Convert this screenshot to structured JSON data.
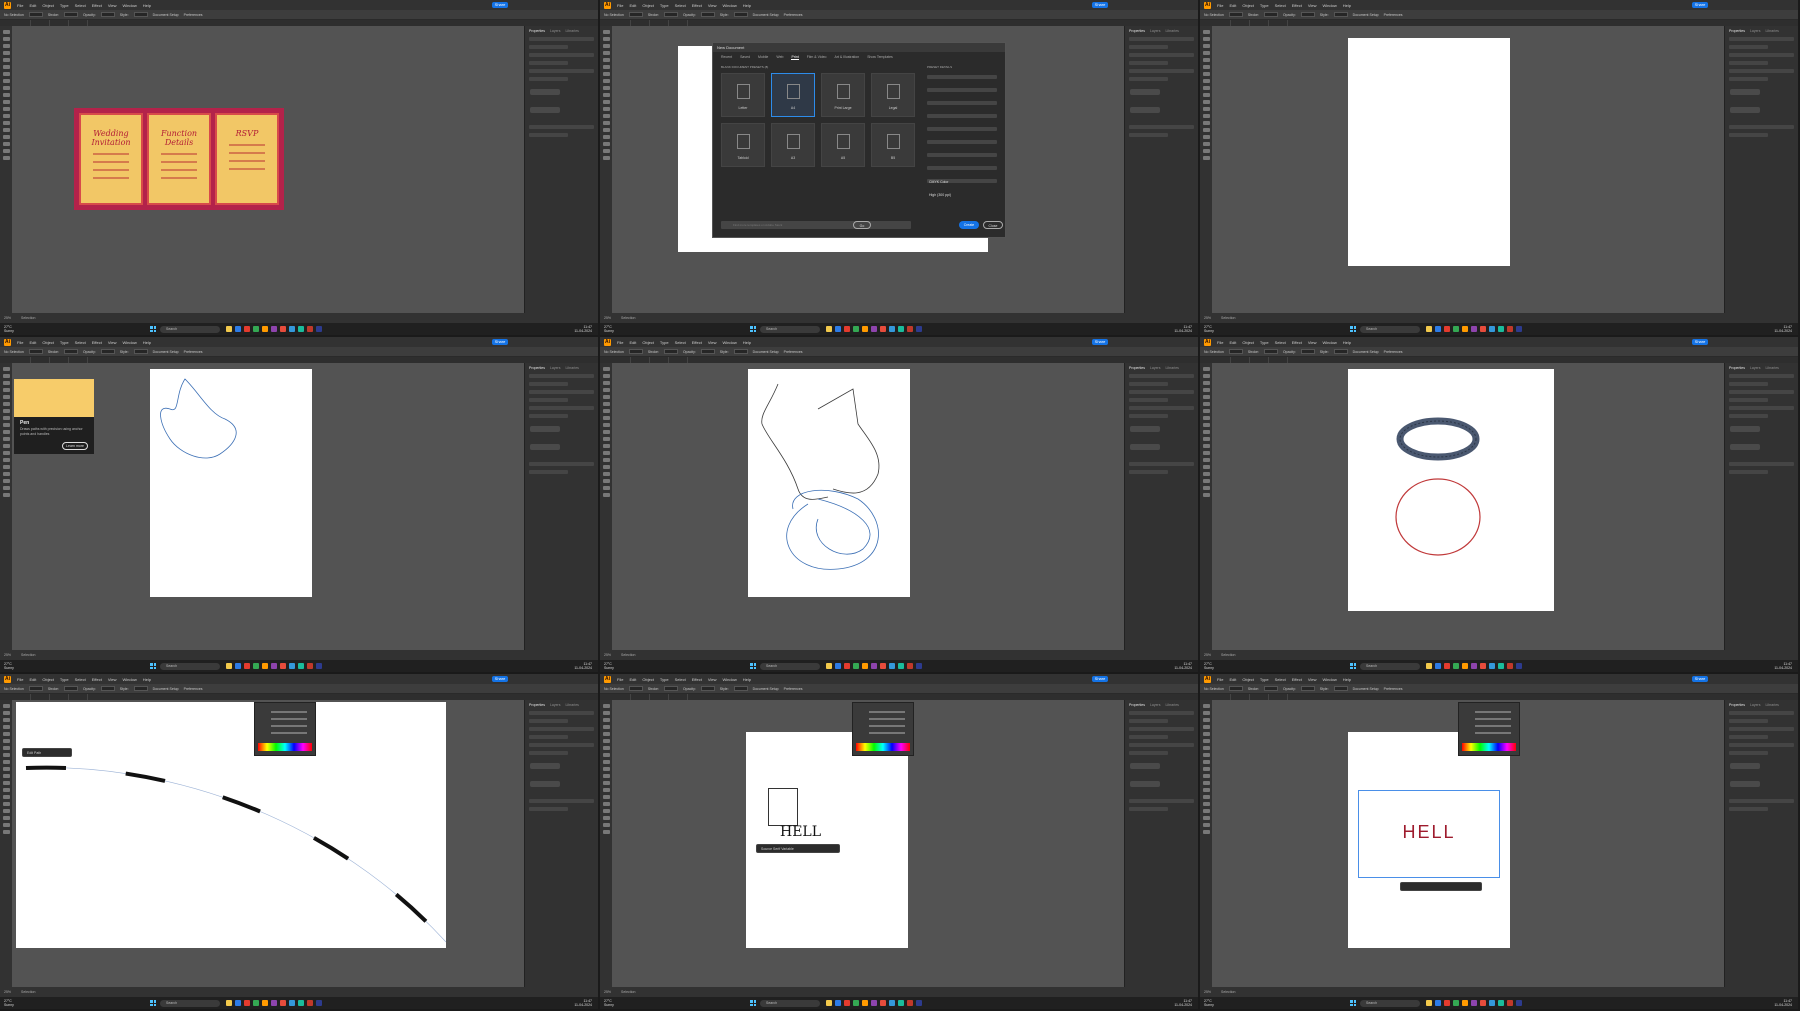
{
  "menu": {
    "app_icon": "Ai",
    "items": [
      "File",
      "Edit",
      "Object",
      "Type",
      "Select",
      "Effect",
      "View",
      "Window",
      "Help"
    ],
    "share_label": "Share"
  },
  "control_bar": {
    "no_selection": "No Selection",
    "stroke_label": "Stroke:",
    "style_label": "Style:",
    "opacity_label": "Opacity:",
    "document_setup": "Document Setup",
    "preferences": "Preferences"
  },
  "right_panel": {
    "tabs": [
      "Properties",
      "Layers",
      "Libraries"
    ],
    "document_setup": "Document Setup",
    "preferences": "Preferences"
  },
  "taskbar": {
    "search_placeholder": "Search",
    "weather": "27°C\nSunny",
    "clock": "11:47\n11-04-2024",
    "icon_colors": [
      "#f2c94c",
      "#2d7be5",
      "#e33b2e",
      "#34a853",
      "#ff9a00",
      "#8e44ad",
      "#e74c3c",
      "#3498db",
      "#1abc9c",
      "#c0392b",
      "#2d3b8e"
    ]
  },
  "panes": [
    {
      "id": "invitation",
      "cards": [
        "Wedding Invitation",
        "Function Details",
        "RSVP"
      ]
    },
    {
      "id": "new-document",
      "dialog_title": "New Document",
      "tabs": [
        "Recent",
        "Saved",
        "Mobile",
        "Web",
        "Print",
        "Film & Video",
        "Art & Illustration",
        "Show Templates"
      ],
      "active_tab": "Print",
      "section_label": "BLANK DOCUMENT PRESETS (8)",
      "presets": [
        "Letter",
        "A4",
        "Print Large",
        "Legal",
        "Tabloid",
        "A3",
        "A5",
        "B5"
      ],
      "details_label": "PRESET DETAILS",
      "color_mode": "CMYK Color",
      "raster": "High (300 ppi)",
      "search_placeholder": "Find more templates on Adobe Stock",
      "go_label": "Go",
      "create_label": "Create",
      "close_label": "Close"
    },
    {
      "id": "blank-artboard"
    },
    {
      "id": "pen-tool",
      "tooltip_title": "Pen",
      "tooltip_desc": "Draws paths with precision using anchor points and handles",
      "tooltip_button": "Learn more"
    },
    {
      "id": "freehand-paths"
    },
    {
      "id": "ellipses"
    },
    {
      "id": "dashed-arc",
      "ctx_label": "Edit Path"
    },
    {
      "id": "type-tool",
      "text": "HELL",
      "ctx_label": "Source Serif Variable"
    },
    {
      "id": "type-red",
      "text": "HELL",
      "text_color": "#9e1b2d"
    }
  ],
  "status": {
    "zoom": "25%",
    "tool": "Selection"
  }
}
